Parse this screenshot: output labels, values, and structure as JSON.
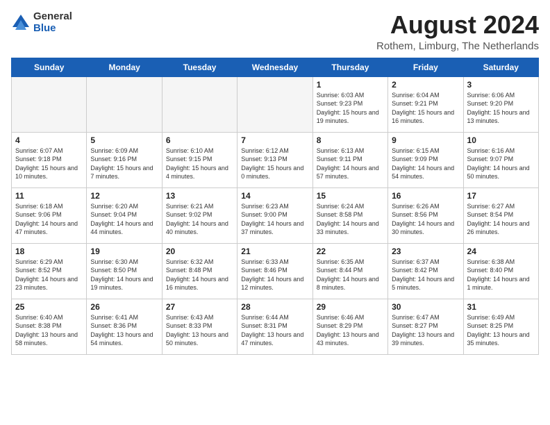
{
  "header": {
    "logo_general": "General",
    "logo_blue": "Blue",
    "title": "August 2024",
    "location": "Rothem, Limburg, The Netherlands"
  },
  "days_of_week": [
    "Sunday",
    "Monday",
    "Tuesday",
    "Wednesday",
    "Thursday",
    "Friday",
    "Saturday"
  ],
  "weeks": [
    [
      {
        "day": "",
        "info": ""
      },
      {
        "day": "",
        "info": ""
      },
      {
        "day": "",
        "info": ""
      },
      {
        "day": "",
        "info": ""
      },
      {
        "day": "1",
        "info": "Sunrise: 6:03 AM\nSunset: 9:23 PM\nDaylight: 15 hours\nand 19 minutes."
      },
      {
        "day": "2",
        "info": "Sunrise: 6:04 AM\nSunset: 9:21 PM\nDaylight: 15 hours\nand 16 minutes."
      },
      {
        "day": "3",
        "info": "Sunrise: 6:06 AM\nSunset: 9:20 PM\nDaylight: 15 hours\nand 13 minutes."
      }
    ],
    [
      {
        "day": "4",
        "info": "Sunrise: 6:07 AM\nSunset: 9:18 PM\nDaylight: 15 hours\nand 10 minutes."
      },
      {
        "day": "5",
        "info": "Sunrise: 6:09 AM\nSunset: 9:16 PM\nDaylight: 15 hours\nand 7 minutes."
      },
      {
        "day": "6",
        "info": "Sunrise: 6:10 AM\nSunset: 9:15 PM\nDaylight: 15 hours\nand 4 minutes."
      },
      {
        "day": "7",
        "info": "Sunrise: 6:12 AM\nSunset: 9:13 PM\nDaylight: 15 hours\nand 0 minutes."
      },
      {
        "day": "8",
        "info": "Sunrise: 6:13 AM\nSunset: 9:11 PM\nDaylight: 14 hours\nand 57 minutes."
      },
      {
        "day": "9",
        "info": "Sunrise: 6:15 AM\nSunset: 9:09 PM\nDaylight: 14 hours\nand 54 minutes."
      },
      {
        "day": "10",
        "info": "Sunrise: 6:16 AM\nSunset: 9:07 PM\nDaylight: 14 hours\nand 50 minutes."
      }
    ],
    [
      {
        "day": "11",
        "info": "Sunrise: 6:18 AM\nSunset: 9:06 PM\nDaylight: 14 hours\nand 47 minutes."
      },
      {
        "day": "12",
        "info": "Sunrise: 6:20 AM\nSunset: 9:04 PM\nDaylight: 14 hours\nand 44 minutes."
      },
      {
        "day": "13",
        "info": "Sunrise: 6:21 AM\nSunset: 9:02 PM\nDaylight: 14 hours\nand 40 minutes."
      },
      {
        "day": "14",
        "info": "Sunrise: 6:23 AM\nSunset: 9:00 PM\nDaylight: 14 hours\nand 37 minutes."
      },
      {
        "day": "15",
        "info": "Sunrise: 6:24 AM\nSunset: 8:58 PM\nDaylight: 14 hours\nand 33 minutes."
      },
      {
        "day": "16",
        "info": "Sunrise: 6:26 AM\nSunset: 8:56 PM\nDaylight: 14 hours\nand 30 minutes."
      },
      {
        "day": "17",
        "info": "Sunrise: 6:27 AM\nSunset: 8:54 PM\nDaylight: 14 hours\nand 26 minutes."
      }
    ],
    [
      {
        "day": "18",
        "info": "Sunrise: 6:29 AM\nSunset: 8:52 PM\nDaylight: 14 hours\nand 23 minutes."
      },
      {
        "day": "19",
        "info": "Sunrise: 6:30 AM\nSunset: 8:50 PM\nDaylight: 14 hours\nand 19 minutes."
      },
      {
        "day": "20",
        "info": "Sunrise: 6:32 AM\nSunset: 8:48 PM\nDaylight: 14 hours\nand 16 minutes."
      },
      {
        "day": "21",
        "info": "Sunrise: 6:33 AM\nSunset: 8:46 PM\nDaylight: 14 hours\nand 12 minutes."
      },
      {
        "day": "22",
        "info": "Sunrise: 6:35 AM\nSunset: 8:44 PM\nDaylight: 14 hours\nand 8 minutes."
      },
      {
        "day": "23",
        "info": "Sunrise: 6:37 AM\nSunset: 8:42 PM\nDaylight: 14 hours\nand 5 minutes."
      },
      {
        "day": "24",
        "info": "Sunrise: 6:38 AM\nSunset: 8:40 PM\nDaylight: 14 hours\nand 1 minute."
      }
    ],
    [
      {
        "day": "25",
        "info": "Sunrise: 6:40 AM\nSunset: 8:38 PM\nDaylight: 13 hours\nand 58 minutes."
      },
      {
        "day": "26",
        "info": "Sunrise: 6:41 AM\nSunset: 8:36 PM\nDaylight: 13 hours\nand 54 minutes."
      },
      {
        "day": "27",
        "info": "Sunrise: 6:43 AM\nSunset: 8:33 PM\nDaylight: 13 hours\nand 50 minutes."
      },
      {
        "day": "28",
        "info": "Sunrise: 6:44 AM\nSunset: 8:31 PM\nDaylight: 13 hours\nand 47 minutes."
      },
      {
        "day": "29",
        "info": "Sunrise: 6:46 AM\nSunset: 8:29 PM\nDaylight: 13 hours\nand 43 minutes."
      },
      {
        "day": "30",
        "info": "Sunrise: 6:47 AM\nSunset: 8:27 PM\nDaylight: 13 hours\nand 39 minutes."
      },
      {
        "day": "31",
        "info": "Sunrise: 6:49 AM\nSunset: 8:25 PM\nDaylight: 13 hours\nand 35 minutes."
      }
    ]
  ]
}
